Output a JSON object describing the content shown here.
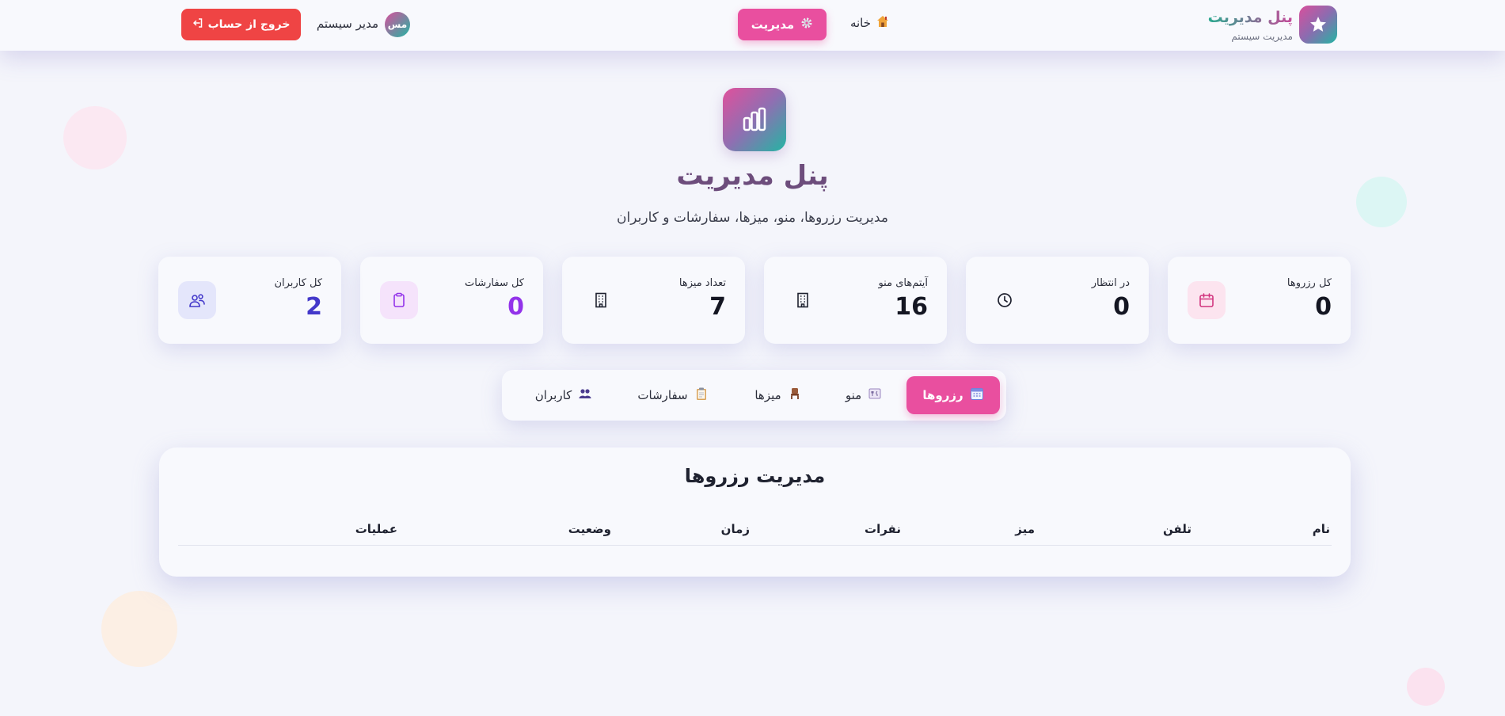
{
  "navbar": {
    "brand_title": "پنل مدیریت",
    "brand_subtitle": "مدیریت سیستم",
    "brand_icon": "star-icon",
    "home_label": "خانه",
    "home_icon": "house-icon",
    "manage_label": "مدیریت",
    "manage_icon": "gear-icon",
    "user_initials": "مس",
    "user_name": "مدیر سیستم",
    "logout_label": "خروج از حساب",
    "logout_icon": "logout-icon"
  },
  "hero": {
    "icon": "chart-bars-icon",
    "title": "پنل مدیریت",
    "subtitle": "مدیریت رزروها، منو، میزها، سفارشات و کاربران"
  },
  "stats": [
    {
      "label": "کل رزروها",
      "value": "0",
      "icon": "calendar-icon"
    },
    {
      "label": "در انتظار",
      "value": "0",
      "icon": "clock-icon"
    },
    {
      "label": "آیتم‌های منو",
      "value": "16",
      "icon": "building-icon"
    },
    {
      "label": "تعداد میزها",
      "value": "7",
      "icon": "building-icon"
    },
    {
      "label": "کل سفارشات",
      "value": "0",
      "icon": "clipboard-icon"
    },
    {
      "label": "کل کاربران",
      "value": "2",
      "icon": "users-icon"
    }
  ],
  "tabs": [
    {
      "label": "رزروها",
      "icon": "calendar-icon",
      "active": true
    },
    {
      "label": "منو",
      "icon": "menu-card-icon",
      "active": false
    },
    {
      "label": "میزها",
      "icon": "chair-icon",
      "active": false
    },
    {
      "label": "سفارشات",
      "icon": "clipboard-icon",
      "active": false
    },
    {
      "label": "کاربران",
      "icon": "users-icon",
      "active": false
    }
  ],
  "reservations": {
    "title": "مدیریت رزروها",
    "columns": [
      "نام",
      "تلفن",
      "میز",
      "نفرات",
      "زمان",
      "وضعیت",
      "عملیات"
    ]
  },
  "colors": {
    "accent_pink": "#e94f9f",
    "logout_red": "#ef4444",
    "teal": "#23b5a3",
    "users_value": "#4338ca",
    "orders_value": "#9333ea"
  }
}
